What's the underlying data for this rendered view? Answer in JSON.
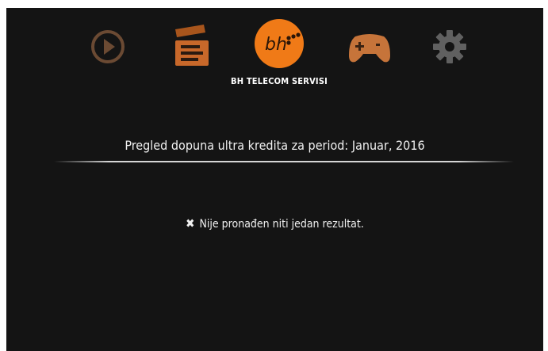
{
  "menu": {
    "items": [
      {
        "name": "play-icon",
        "label": ""
      },
      {
        "name": "clapperboard-icon",
        "label": ""
      },
      {
        "name": "bh-logo-icon",
        "label": "BH TELECOM SERVISI"
      },
      {
        "name": "gamepad-icon",
        "label": ""
      },
      {
        "name": "gear-icon",
        "label": ""
      }
    ],
    "active_label": "BH TELECOM SERVISI",
    "logo_text": "bh",
    "colors": {
      "active": "#f07a17",
      "inactive": "#7a4a28",
      "inactive_gray": "#5a5a5a"
    }
  },
  "main": {
    "heading": "Pregled dopuna ultra kredita za period: Januar, 2016",
    "empty_icon": "✖",
    "empty_message": "Nije pronađen niti jedan rezultat."
  }
}
